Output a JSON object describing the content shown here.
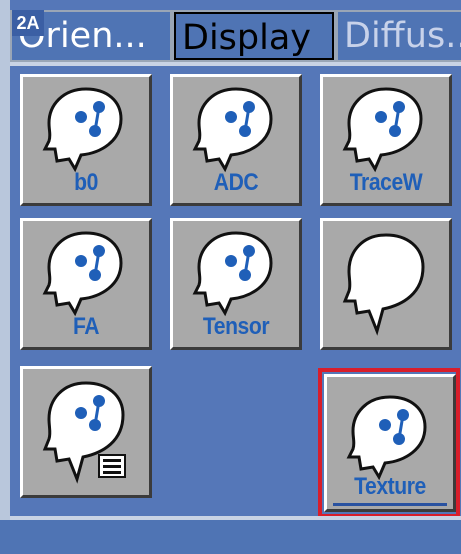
{
  "figure_label": "2A",
  "tabs": [
    {
      "label": "Orien..."
    },
    {
      "label": "Display"
    },
    {
      "label": "Diffus..."
    }
  ],
  "buttons": [
    {
      "label": "b0",
      "icon": "head-dots-icon"
    },
    {
      "label": "ADC",
      "icon": "head-dots-icon"
    },
    {
      "label": "TraceW",
      "icon": "head-dots-icon"
    },
    {
      "label": "FA",
      "icon": "head-dots-icon"
    },
    {
      "label": "Tensor",
      "icon": "head-dots-icon"
    },
    {
      "label": "",
      "icon": "head-outline-icon"
    },
    {
      "label": "",
      "icon": "head-dots-card-icon"
    },
    {
      "label": "Texture",
      "icon": "head-dots-icon",
      "selected": true
    }
  ],
  "colors": {
    "background": "#5577b8",
    "button": "#a9a9a9",
    "label": "#1f5fb8",
    "selection": "#d81e2b"
  }
}
